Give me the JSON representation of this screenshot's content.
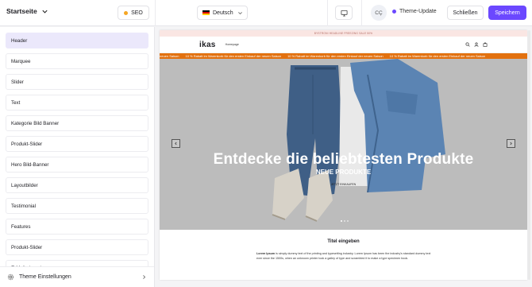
{
  "colors": {
    "accent": "#6b48ff",
    "seo_dot": "#f5a623",
    "theme_dot": "#6b48ff",
    "marquee_bg": "#e2710f"
  },
  "topbar": {
    "page_select": "Startseite",
    "seo_label": "SEO",
    "language": "Deutsch",
    "avatar_initials": "CÇ",
    "theme_update_label": "Theme-Update",
    "close_label": "Schließen",
    "save_label": "Speichern"
  },
  "sidebar": {
    "sections": [
      {
        "label": "Header"
      },
      {
        "label": "Marquee"
      },
      {
        "label": "Slider"
      },
      {
        "label": "Text"
      },
      {
        "label": "Kategorie Bild Banner"
      },
      {
        "label": "Produkt-Slider"
      },
      {
        "label": "Hero Bild-Banner"
      },
      {
        "label": "Layoutbilder"
      },
      {
        "label": "Testimonial"
      },
      {
        "label": "Features"
      },
      {
        "label": "Produkt-Slider"
      },
      {
        "label": "E-Mail abonnieren"
      }
    ],
    "theme_settings_label": "Theme Einstellungen"
  },
  "preview": {
    "announcement": "BYSTRONI HEADLINE FREEZING SALE 50%",
    "logo": "ikas",
    "nav_link": "Homepage",
    "marquee_items": [
      "neuen Saison",
      "10 % Rabatt im Warenkorb für den ersten Einkauf der neuen Saison",
      "10 % Rabatt im Warenkorb für den ersten Einkauf der neuen Saison",
      "10 % Rabatt im Warenkorb für den ersten Einkauf der neuen Saison"
    ],
    "hero": {
      "title": "Entdecke die beliebtesten Produkte",
      "subtitle": "NEUE PRODUKTE",
      "cta": "JETZT EINKAUFEN"
    },
    "text_section": {
      "title": "Titel eingeben",
      "body_bold": "Lorem Ipsum",
      "body": " is simply dummy text of the printing and typesetting industry. Lorem Ipsum has been the industry's standard dummy text ever since the 1500s, when an unknown printer took a galley of type and scrambled it to make a type specimen book."
    }
  }
}
